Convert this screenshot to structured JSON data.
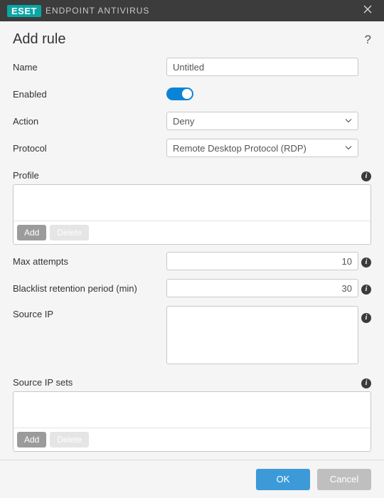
{
  "titlebar": {
    "brand": "ESET",
    "product": "ENDPOINT ANTIVIRUS"
  },
  "page_title": "Add rule",
  "fields": {
    "name": {
      "label": "Name",
      "value": "Untitled"
    },
    "enabled": {
      "label": "Enabled",
      "value": true
    },
    "action": {
      "label": "Action",
      "selected": "Deny"
    },
    "protocol": {
      "label": "Protocol",
      "selected": "Remote Desktop Protocol (RDP)"
    },
    "profile": {
      "label": "Profile",
      "add": "Add",
      "delete": "Delete"
    },
    "max_attempts": {
      "label": "Max attempts",
      "value": "10"
    },
    "blacklist_retention": {
      "label": "Blacklist retention period (min)",
      "value": "30"
    },
    "source_ip": {
      "label": "Source IP",
      "value": ""
    },
    "source_ip_sets": {
      "label": "Source IP sets",
      "add": "Add",
      "delete": "Delete"
    }
  },
  "footer": {
    "ok": "OK",
    "cancel": "Cancel"
  }
}
